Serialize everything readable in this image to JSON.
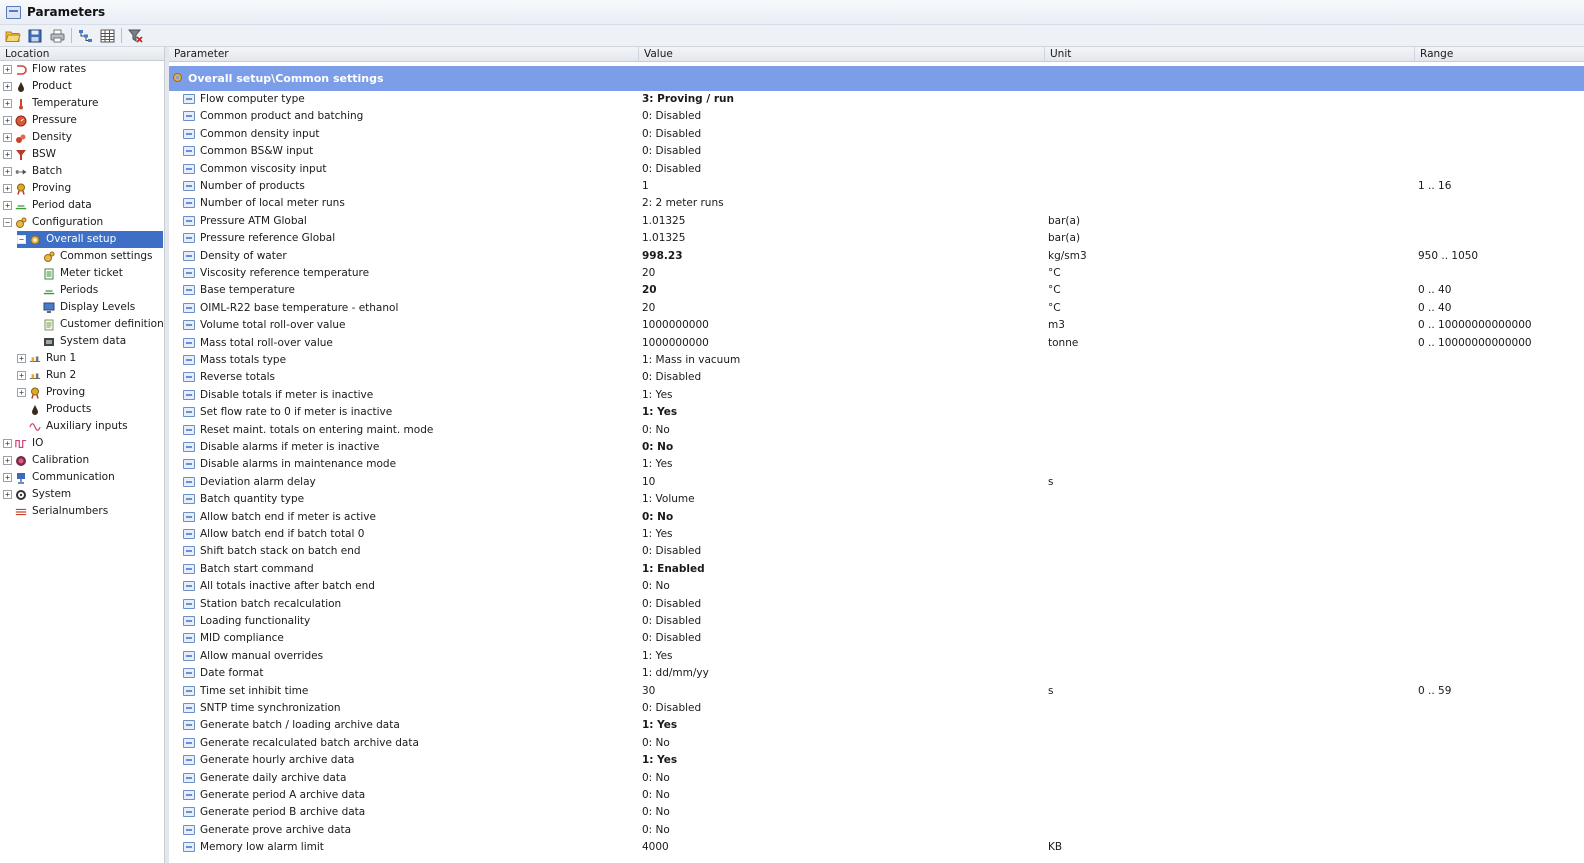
{
  "window": {
    "title": "Parameters"
  },
  "toolbar": {
    "buttons": [
      "open-folder-icon",
      "save-icon",
      "print-icon",
      "tree-view-icon",
      "grid-view-icon",
      "filter-clear-icon"
    ]
  },
  "left_panel": {
    "header": "Location",
    "items": [
      {
        "label": "Flow rates",
        "level": 0,
        "expander": "+",
        "icon": "flow-rates-icon"
      },
      {
        "label": "Product",
        "level": 0,
        "expander": "+",
        "icon": "product-drop-icon"
      },
      {
        "label": "Temperature",
        "level": 0,
        "expander": "+",
        "icon": "thermometer-icon"
      },
      {
        "label": "Pressure",
        "level": 0,
        "expander": "+",
        "icon": "pressure-gauge-icon"
      },
      {
        "label": "Density",
        "level": 0,
        "expander": "+",
        "icon": "density-icon"
      },
      {
        "label": "BSW",
        "level": 0,
        "expander": "+",
        "icon": "bsw-funnel-icon"
      },
      {
        "label": "Batch",
        "level": 0,
        "expander": "+",
        "icon": "batch-icon"
      },
      {
        "label": "Proving",
        "level": 0,
        "expander": "+",
        "icon": "proving-medal-icon"
      },
      {
        "label": "Period data",
        "level": 0,
        "expander": "+",
        "icon": "period-icon"
      },
      {
        "label": "Configuration",
        "level": 0,
        "expander": "−",
        "icon": "configuration-gear-icon"
      },
      {
        "label": "Overall setup",
        "level": 1,
        "expander": "−",
        "icon": "settings-gear-icon",
        "selected": true
      },
      {
        "label": "Common settings",
        "level": 2,
        "expander": "",
        "icon": "common-settings-icon"
      },
      {
        "label": "Meter ticket",
        "level": 2,
        "expander": "",
        "icon": "ticket-icon"
      },
      {
        "label": "Periods",
        "level": 2,
        "expander": "",
        "icon": "period-icon"
      },
      {
        "label": "Display Levels",
        "level": 2,
        "expander": "",
        "icon": "monitor-icon"
      },
      {
        "label": "Customer definition",
        "level": 2,
        "expander": "",
        "icon": "document-icon"
      },
      {
        "label": "System data",
        "level": 2,
        "expander": "",
        "icon": "system-data-icon"
      },
      {
        "label": "Run 1",
        "level": 1,
        "expander": "+",
        "icon": "run-icon"
      },
      {
        "label": "Run 2",
        "level": 1,
        "expander": "+",
        "icon": "run-icon"
      },
      {
        "label": "Proving",
        "level": 1,
        "expander": "+",
        "icon": "proving-medal-icon"
      },
      {
        "label": "Products",
        "level": 1,
        "expander": "",
        "icon": "product-drop-icon"
      },
      {
        "label": "Auxiliary inputs",
        "level": 1,
        "expander": "",
        "icon": "wave-icon"
      },
      {
        "label": "IO",
        "level": 0,
        "expander": "+",
        "icon": "io-icon"
      },
      {
        "label": "Calibration",
        "level": 0,
        "expander": "+",
        "icon": "calibration-icon"
      },
      {
        "label": "Communication",
        "level": 0,
        "expander": "+",
        "icon": "communication-icon"
      },
      {
        "label": "System",
        "level": 0,
        "expander": "+",
        "icon": "system-gear-icon"
      },
      {
        "label": "Serialnumbers",
        "level": 0,
        "expander": "",
        "icon": "serial-list-icon"
      }
    ]
  },
  "grid": {
    "columns": [
      "Parameter",
      "Value",
      "Unit",
      "Range"
    ],
    "group_title": "Overall setup\\Common settings",
    "rows": [
      {
        "param": "Flow computer type",
        "value": "3: Proving / run",
        "bold": true,
        "unit": "",
        "range": ""
      },
      {
        "param": "Common product and batching",
        "value": "0: Disabled",
        "bold": false,
        "unit": "",
        "range": ""
      },
      {
        "param": "Common density input",
        "value": "0: Disabled",
        "bold": false,
        "unit": "",
        "range": ""
      },
      {
        "param": "Common BS&W input",
        "value": "0: Disabled",
        "bold": false,
        "unit": "",
        "range": ""
      },
      {
        "param": "Common viscosity input",
        "value": "0: Disabled",
        "bold": false,
        "unit": "",
        "range": ""
      },
      {
        "param": "Number of products",
        "value": "1",
        "bold": false,
        "unit": "",
        "range": "1 .. 16"
      },
      {
        "param": "Number of local meter runs",
        "value": "2: 2 meter runs",
        "bold": false,
        "unit": "",
        "range": ""
      },
      {
        "param": "Pressure ATM Global",
        "value": "1.01325",
        "bold": false,
        "unit": "bar(a)",
        "range": ""
      },
      {
        "param": "Pressure reference Global",
        "value": "1.01325",
        "bold": false,
        "unit": "bar(a)",
        "range": ""
      },
      {
        "param": "Density of water",
        "value": "998.23",
        "bold": true,
        "unit": "kg/sm3",
        "range": "950 .. 1050"
      },
      {
        "param": "Viscosity reference temperature",
        "value": "20",
        "bold": false,
        "unit": "°C",
        "range": ""
      },
      {
        "param": "Base temperature",
        "value": "20",
        "bold": true,
        "unit": "°C",
        "range": "0 .. 40"
      },
      {
        "param": "OIML-R22 base temperature - ethanol",
        "value": "20",
        "bold": false,
        "unit": "°C",
        "range": "0 .. 40"
      },
      {
        "param": "Volume total roll-over value",
        "value": "1000000000",
        "bold": false,
        "unit": "m3",
        "range": "0 .. 10000000000000"
      },
      {
        "param": "Mass total roll-over value",
        "value": "1000000000",
        "bold": false,
        "unit": "tonne",
        "range": "0 .. 10000000000000"
      },
      {
        "param": "Mass totals type",
        "value": "1: Mass in vacuum",
        "bold": false,
        "unit": "",
        "range": ""
      },
      {
        "param": "Reverse totals",
        "value": "0: Disabled",
        "bold": false,
        "unit": "",
        "range": ""
      },
      {
        "param": "Disable totals if meter is inactive",
        "value": "1: Yes",
        "bold": false,
        "unit": "",
        "range": ""
      },
      {
        "param": "Set flow rate to 0 if meter is inactive",
        "value": "1: Yes",
        "bold": true,
        "unit": "",
        "range": ""
      },
      {
        "param": "Reset maint. totals on entering maint. mode",
        "value": "0: No",
        "bold": false,
        "unit": "",
        "range": ""
      },
      {
        "param": "Disable alarms if meter is inactive",
        "value": "0: No",
        "bold": true,
        "unit": "",
        "range": ""
      },
      {
        "param": "Disable alarms in maintenance mode",
        "value": "1: Yes",
        "bold": false,
        "unit": "",
        "range": ""
      },
      {
        "param": "Deviation alarm delay",
        "value": "10",
        "bold": false,
        "unit": "s",
        "range": ""
      },
      {
        "param": "Batch quantity type",
        "value": "1: Volume",
        "bold": false,
        "unit": "",
        "range": ""
      },
      {
        "param": "Allow batch end if meter is active",
        "value": "0: No",
        "bold": true,
        "unit": "",
        "range": ""
      },
      {
        "param": "Allow batch end if batch total 0",
        "value": "1: Yes",
        "bold": false,
        "unit": "",
        "range": ""
      },
      {
        "param": "Shift batch stack on batch end",
        "value": "0: Disabled",
        "bold": false,
        "unit": "",
        "range": ""
      },
      {
        "param": "Batch start command",
        "value": "1: Enabled",
        "bold": true,
        "unit": "",
        "range": ""
      },
      {
        "param": "All totals inactive after batch end",
        "value": "0: No",
        "bold": false,
        "unit": "",
        "range": ""
      },
      {
        "param": "Station batch recalculation",
        "value": "0: Disabled",
        "bold": false,
        "unit": "",
        "range": ""
      },
      {
        "param": "Loading functionality",
        "value": "0: Disabled",
        "bold": false,
        "unit": "",
        "range": ""
      },
      {
        "param": "MID compliance",
        "value": "0: Disabled",
        "bold": false,
        "unit": "",
        "range": ""
      },
      {
        "param": "Allow manual overrides",
        "value": "1: Yes",
        "bold": false,
        "unit": "",
        "range": ""
      },
      {
        "param": "Date format",
        "value": "1: dd/mm/yy",
        "bold": false,
        "unit": "",
        "range": ""
      },
      {
        "param": "Time set inhibit time",
        "value": "30",
        "bold": false,
        "unit": "s",
        "range": "0 .. 59"
      },
      {
        "param": "SNTP time synchronization",
        "value": "0: Disabled",
        "bold": false,
        "unit": "",
        "range": ""
      },
      {
        "param": "Generate batch / loading archive data",
        "value": "1: Yes",
        "bold": true,
        "unit": "",
        "range": ""
      },
      {
        "param": "Generate recalculated batch archive data",
        "value": "0: No",
        "bold": false,
        "unit": "",
        "range": ""
      },
      {
        "param": "Generate hourly archive data",
        "value": "1: Yes",
        "bold": true,
        "unit": "",
        "range": ""
      },
      {
        "param": "Generate daily archive data",
        "value": "0: No",
        "bold": false,
        "unit": "",
        "range": ""
      },
      {
        "param": "Generate period A archive data",
        "value": "0: No",
        "bold": false,
        "unit": "",
        "range": ""
      },
      {
        "param": "Generate period B archive data",
        "value": "0: No",
        "bold": false,
        "unit": "",
        "range": ""
      },
      {
        "param": "Generate prove archive data",
        "value": "0: No",
        "bold": false,
        "unit": "",
        "range": ""
      },
      {
        "param": "Memory low alarm limit",
        "value": "4000",
        "bold": false,
        "unit": "KB",
        "range": ""
      }
    ]
  }
}
